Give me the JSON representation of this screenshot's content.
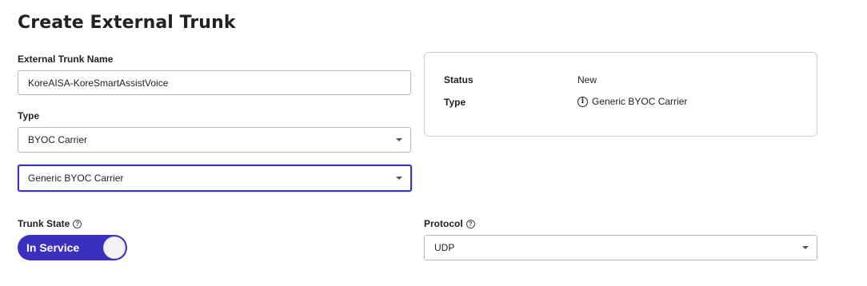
{
  "page": {
    "title": "Create External Trunk"
  },
  "form": {
    "trunk_name": {
      "label": "External Trunk Name",
      "value": "KoreAISA-KoreSmartAssistVoice"
    },
    "type": {
      "label": "Type",
      "value": "BYOC Carrier"
    },
    "subtype": {
      "value": "Generic BYOC Carrier"
    },
    "trunk_state": {
      "label": "Trunk State",
      "help_icon": "help-icon",
      "value": "In Service",
      "enabled": true
    },
    "protocol": {
      "label": "Protocol",
      "help_icon": "help-icon",
      "value": "UDP"
    }
  },
  "summary": {
    "status_label": "Status",
    "status_value": "New",
    "type_label": "Type",
    "type_value": "Generic BYOC Carrier",
    "type_icon": "info-icon"
  },
  "colors": {
    "accent": "#3b2fbf",
    "focus_border": "#3b35b5"
  }
}
